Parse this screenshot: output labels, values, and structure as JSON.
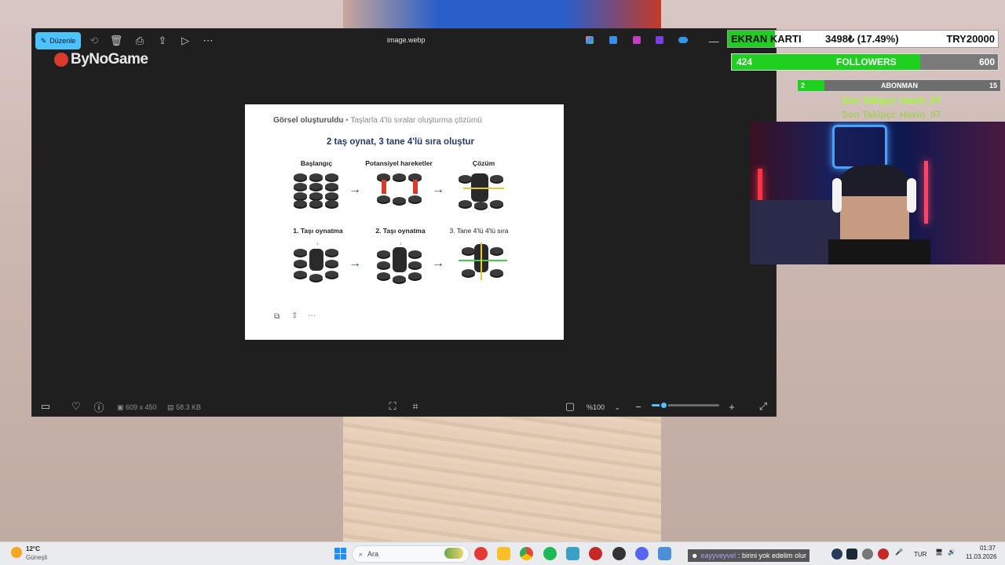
{
  "viewer": {
    "edit_label": "Düzenle",
    "title": "image.webp",
    "watermark": "ByNoGame",
    "dimensions": "609 x 450",
    "filesize": "58.3 KB",
    "zoom": "%100",
    "zoom_fraction": 0.17
  },
  "image": {
    "header": "Görsel oluşturuldu",
    "header_sub": "• Taşlarla 4'lü sıralar oluşturma çözümü",
    "title": "2 taş oynat, 3 tane 4'lü sıra oluştur",
    "top_labels": [
      "Başlangıç",
      "Potansiyel hareketler",
      "Çözüm"
    ],
    "bottom_labels": [
      "1. Taşı oynatma",
      "2. Taşı oynatma",
      "3. Tane 4'lü 4'lü sıra"
    ]
  },
  "overlays": {
    "gpu_label": "EKRAN KARTI",
    "gpu_value": "3498₺ (17.49%)",
    "gpu_target": "TRY20000",
    "gpu_progress": 0.1749,
    "followers_current": "424",
    "followers_label": "FOLLOWERS",
    "followers_goal": "600",
    "followers_progress": 0.707,
    "subs_current": "2",
    "subs_label": "ABONMAN",
    "subs_goal": "15",
    "subs_progress": 0.133,
    "last_follower": "Son Takipçi: Havin_07"
  },
  "taskbar": {
    "weather_temp": "12°C",
    "weather_desc": "Güneşli",
    "search_placeholder": "Ara",
    "chat_user": "eayyveyvel",
    "chat_text": ": birini yok edelim olur",
    "lang": "TUR",
    "time": "01:37",
    "date": "11.03.2026"
  },
  "colors": {
    "accent": "#4cc2ff",
    "progress_green": "#22cc22",
    "title_navy": "#273a66"
  }
}
